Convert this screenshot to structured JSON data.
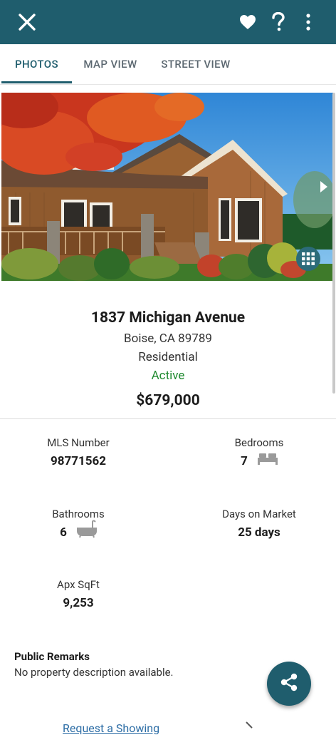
{
  "header": {
    "close_icon": "close-icon",
    "favorite_icon": "heart-icon",
    "help_icon": "help-icon",
    "more_icon": "more-vertical-icon",
    "background_color": "#1f5d6d"
  },
  "tabs": [
    {
      "label": "PHOTOS",
      "active": true
    },
    {
      "label": "MAP VIEW",
      "active": false
    },
    {
      "label": "STREET VIEW",
      "active": false
    }
  ],
  "photo": {
    "next_icon": "chevron-right-icon",
    "grid_icon": "grid-icon"
  },
  "listing": {
    "address": "1837 Michigan Avenue",
    "city_state_zip": "Boise, CA 89789",
    "type": "Residential",
    "status": "Active",
    "price": "$679,000",
    "status_color": "#1f8a2f"
  },
  "details": {
    "mls_label": "MLS Number",
    "mls_value": "98771562",
    "bedrooms_label": "Bedrooms",
    "bedrooms_value": "7",
    "bathrooms_label": "Bathrooms",
    "bathrooms_value": "6",
    "days_label": "Days on Market",
    "days_value": "25 days",
    "sqft_label": "Apx SqFt",
    "sqft_value": "9,253"
  },
  "remarks": {
    "title": "Public Remarks",
    "text": "No property description available."
  },
  "actions": {
    "share_icon": "share-icon",
    "request_showing": "Request a Showing"
  }
}
